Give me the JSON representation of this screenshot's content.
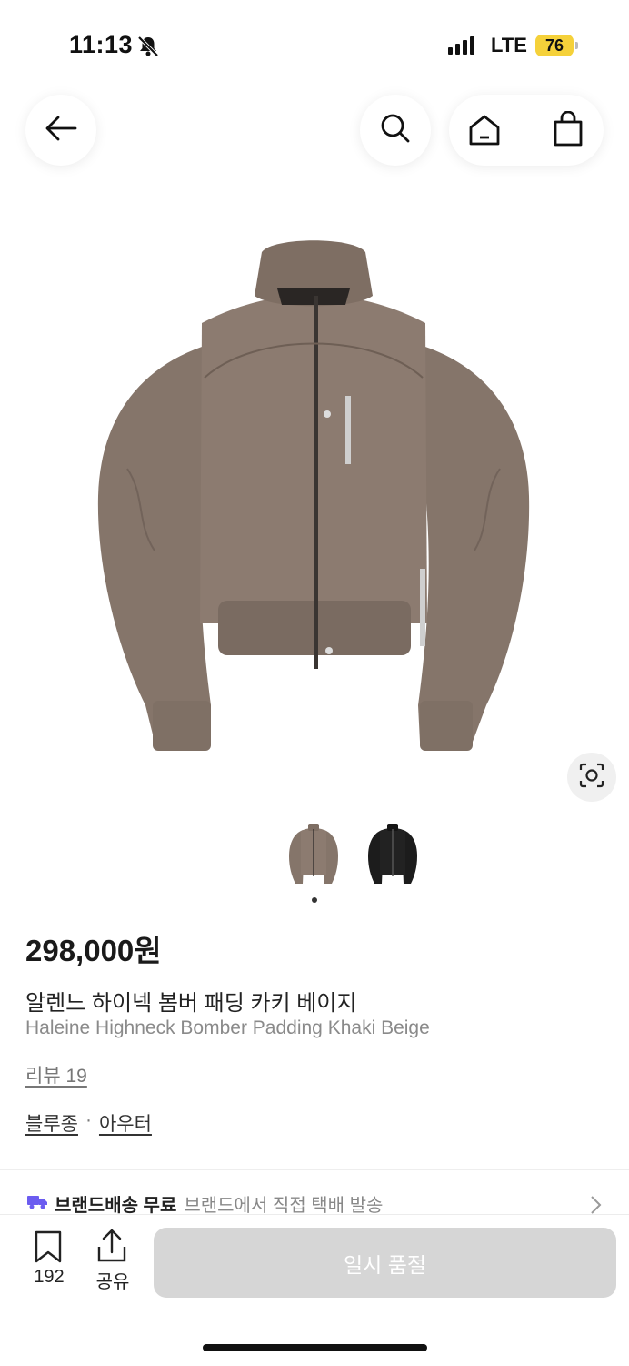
{
  "status_bar": {
    "time": "11:13",
    "network": "LTE",
    "battery": "76",
    "battery_color": "#f5d13a"
  },
  "nav": {
    "back_icon": "arrow-left-icon",
    "search_icon": "search-icon",
    "home_icon": "home-icon",
    "bag_icon": "shopping-bag-icon"
  },
  "product": {
    "price": "298,000원",
    "name_ko": "알렌느 하이넥 봄버 패딩 카키 베이지",
    "name_en": "Haleine Highneck Bomber Padding Khaki Beige",
    "review_link": "리뷰 19",
    "category_1": "블루종",
    "separator": "·",
    "category_2": "아우터",
    "jacket_color": "#8c7b70"
  },
  "gallery": {
    "thumbnails": [
      "khaki-beige-jacket",
      "black-jacket"
    ],
    "active_index": 0
  },
  "delivery": {
    "icon": "truck-icon",
    "label": "브랜드배송 무료",
    "description": "브랜드에서 직접 택배 발송",
    "accent_color": "#6b5cf0"
  },
  "bottom_bar": {
    "bookmark_count": "192",
    "share_label": "공유",
    "sold_out_label": "일시 품절"
  }
}
